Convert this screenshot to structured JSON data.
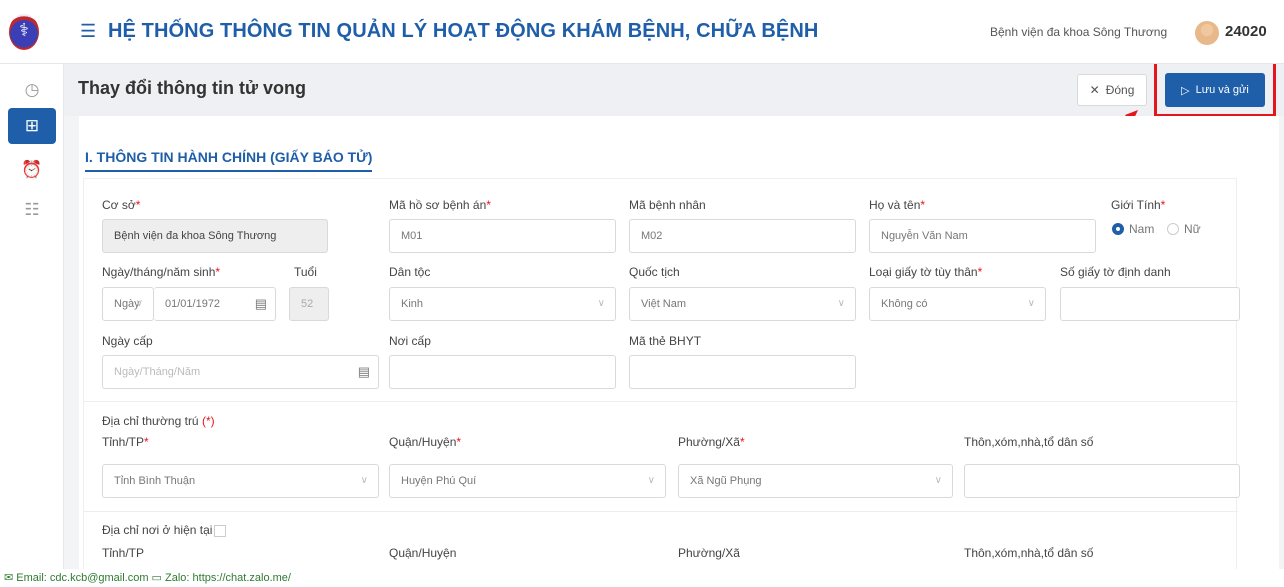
{
  "header": {
    "title": "HỆ THỐNG THÔNG TIN QUẢN LÝ HOẠT ĐỘNG KHÁM BỆNH, CHỮA BỆNH",
    "hospital": "Bệnh viện đa khoa Sông Thương",
    "user_id": "24020"
  },
  "sidebar": {
    "items": [
      {
        "icon": "dashboard-icon"
      },
      {
        "icon": "medical-kit-icon",
        "active": true
      },
      {
        "icon": "alarm-icon"
      },
      {
        "icon": "list-icon"
      }
    ]
  },
  "page": {
    "title": "Thay đổi thông tin tử vong",
    "close_label": "Đóng",
    "save_label": "Lưu và gửi"
  },
  "section": {
    "title": "I. THÔNG TIN HÀNH CHÍNH (GIẤY BÁO TỬ)"
  },
  "form": {
    "co_so": {
      "label": "Cơ sở",
      "value": "Bệnh viện đa khoa Sông Thương"
    },
    "ma_ho_so": {
      "label": "Mã hồ sơ bệnh án",
      "value": "M01"
    },
    "ma_benh_nhan": {
      "label": "Mã bệnh nhân",
      "value": "M02"
    },
    "ho_ten": {
      "label": "Họ và tên",
      "value": "Nguyễn Văn Nam"
    },
    "gioi_tinh": {
      "label": "Giới Tính",
      "options": [
        "Nam",
        "Nữ"
      ],
      "selected": "Nam"
    },
    "ngay_sinh": {
      "label": "Ngày/tháng/năm sinh",
      "type_value": "Ngày",
      "date_value": "01/01/1972"
    },
    "tuoi": {
      "label": "Tuổi",
      "value": "52"
    },
    "dan_toc": {
      "label": "Dân tộc",
      "value": "Kinh"
    },
    "quoc_tich": {
      "label": "Quốc tịch",
      "value": "Việt Nam"
    },
    "loai_giay_to": {
      "label": "Loại giấy tờ tùy thân",
      "value": "Không có"
    },
    "so_giay_to": {
      "label": "Số giấy tờ định danh",
      "value": ""
    },
    "ngay_cap": {
      "label": "Ngày cấp",
      "placeholder": "Ngày/Tháng/Năm"
    },
    "noi_cap": {
      "label": "Nơi cấp",
      "value": ""
    },
    "ma_bhyt": {
      "label": "Mã thẻ BHYT",
      "value": ""
    },
    "dia_chi_thuong_tru": {
      "label": "Địa chỉ thường trú",
      "req_mark": "(*)",
      "tinh_label": "Tỉnh/TP",
      "tinh_value": "Tỉnh Bình Thuận",
      "quan_label": "Quận/Huyện",
      "quan_value": "Huyện Phú Quí",
      "phuong_label": "Phường/Xã",
      "phuong_value": "Xã Ngũ Phụng",
      "thon_label": "Thôn,xóm,nhà,tổ dân số",
      "thon_value": ""
    },
    "dia_chi_hien_tai": {
      "label": "Địa chỉ nơi ở hiện tại",
      "tinh_label": "Tỉnh/TP",
      "quan_label": "Quận/Huyện",
      "phuong_label": "Phường/Xã",
      "thon_label": "Thôn,xóm,nhà,tổ dân số"
    }
  },
  "footer": {
    "email": "Email: cdc.kcb@gmail.com",
    "zalo": "Zalo: https://chat.zalo.me/"
  },
  "colors": {
    "primary": "#1f5ea8",
    "highlight": "#e5161b"
  }
}
